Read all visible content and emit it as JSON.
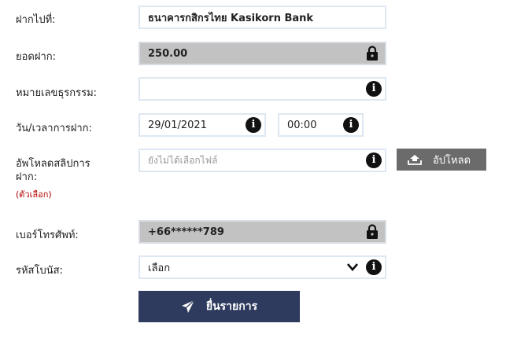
{
  "form": {
    "deposit_to": {
      "label": "ฝากไปที่:",
      "value": "ธนาคารกสิกรไทย Kasikorn Bank"
    },
    "amount": {
      "label": "ยอดฝาก:",
      "value": "250.00",
      "icon": "lock-icon"
    },
    "reference": {
      "label": "หมายเลขธุรกรรม:",
      "value": "",
      "icon": "info-icon"
    },
    "datetime": {
      "label": "วัน/เวลาการฝาก:",
      "date": "29/01/2021",
      "time": "00:00",
      "icon": "info-icon"
    },
    "upload": {
      "label_line1": "อัพโหลดสลิปการ",
      "label_line2": "ฝาก:",
      "optional": "(ตัวเลือก)",
      "placeholder": "ยังไม่ได้เลือกไฟล์",
      "button_label": "อัปโหลด",
      "button_icon": "upload-icon"
    },
    "phone": {
      "label": "เบอร์โทรศัพท์:",
      "value": "+66******789",
      "icon": "lock-icon"
    },
    "promo_code": {
      "label": "รหัสโบนัส:",
      "selected": "เลือก",
      "icon": "chevron-down-icon"
    },
    "submit": {
      "label": "ยื่นรายการ",
      "icon": "send-icon"
    }
  },
  "colors": {
    "submit_bg": "#2e3a5e",
    "upload_bg": "#6b6b6b",
    "locked_bg": "#c2c2c2",
    "field_border": "#dde8f2",
    "optional_text": "#b30000"
  }
}
